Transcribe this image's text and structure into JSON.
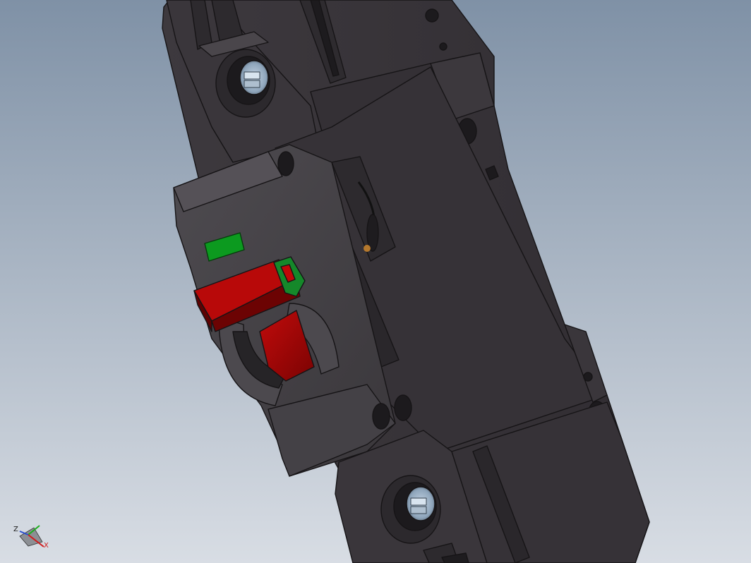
{
  "viewport": {
    "background_top": "#7f91a6",
    "background_bottom": "#d8dde4",
    "model_name": "miniature-circuit-breaker",
    "body_color": "#3b373c",
    "body_shadow_color": "#2c292d",
    "edge_color": "#161416",
    "toggle_color": "#a10606",
    "indicator_color": "#0c9a1f",
    "terminal_screw_color": "#8fa7bf"
  },
  "triad": {
    "axis_z_label": "Z",
    "axis_x_label": "X",
    "x_color": "#d11a1a",
    "y_color": "#1cae1c",
    "z_color": "#2a4fd0"
  },
  "icons": [
    "triad-icon"
  ]
}
